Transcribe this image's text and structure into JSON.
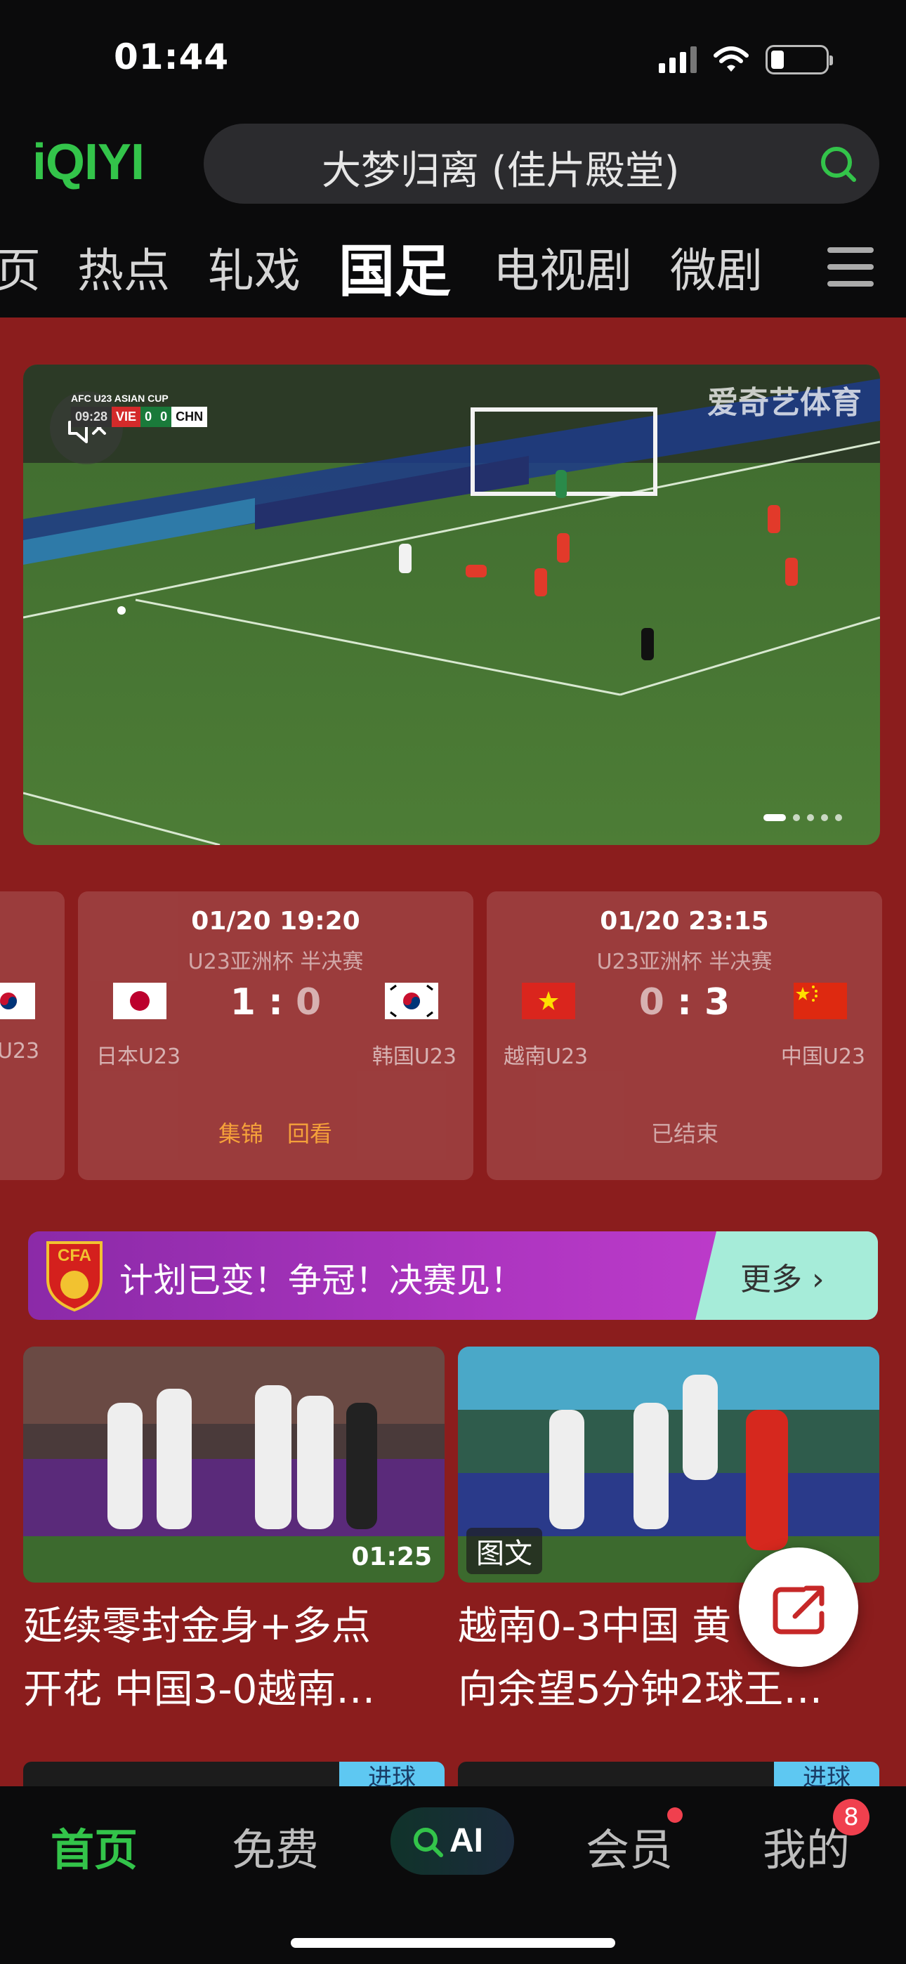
{
  "status": {
    "time": "01:44"
  },
  "header": {
    "logo": "iQIYI",
    "search_placeholder": "大梦归离 (佳片殿堂)"
  },
  "nav": {
    "items": [
      "页",
      "热点",
      "轧戏",
      "国足",
      "电视剧",
      "微剧"
    ],
    "active": "国足"
  },
  "hero": {
    "watermark": "爱奇艺体育",
    "scorebug": {
      "cup": "AFC U23 ASIAN CUP",
      "clock": "09:28",
      "home": "VIE",
      "home_score": "0",
      "away_score": "0",
      "away": "CHN"
    },
    "page_count": 5,
    "current_page": 1
  },
  "matches": [
    {
      "partial_team": "U23"
    },
    {
      "date": "01/20 19:20",
      "stage": "U23亚洲杯 半决赛",
      "home_score": "1",
      "separator": ":",
      "away_score": "0",
      "home": "日本U23",
      "away": "韩国U23",
      "action1": "集锦",
      "action2": "回看"
    },
    {
      "date": "01/20 23:15",
      "stage": "U23亚洲杯 半决赛",
      "home_score": "0",
      "separator": ":",
      "away_score": "3",
      "home": "越南U23",
      "away": "中国U23",
      "status": "已结束"
    }
  ],
  "banner": {
    "logo_text": "CFA",
    "text": "计划已变！争冠！决赛见！",
    "more": "更多 ›"
  },
  "news": [
    {
      "title_line1": "延续零封金身+多点",
      "title_line2": "开花 中国3-0越南…",
      "duration": "01:25"
    },
    {
      "title_line1": "越南0-3中国 黄",
      "title_line2": "向余望5分钟2球王…",
      "tag": "图文"
    }
  ],
  "peek": [
    {
      "tag": "进球"
    },
    {
      "tag": "进球"
    }
  ],
  "tabbar": {
    "home": "首页",
    "free": "免费",
    "ai": "AI",
    "vip": "会员",
    "mine": "我的",
    "mine_badge": "8"
  },
  "colors": {
    "brand": "#33c44a",
    "page_bg": "#8b1d1d",
    "accent_orange": "#f5a13a"
  }
}
